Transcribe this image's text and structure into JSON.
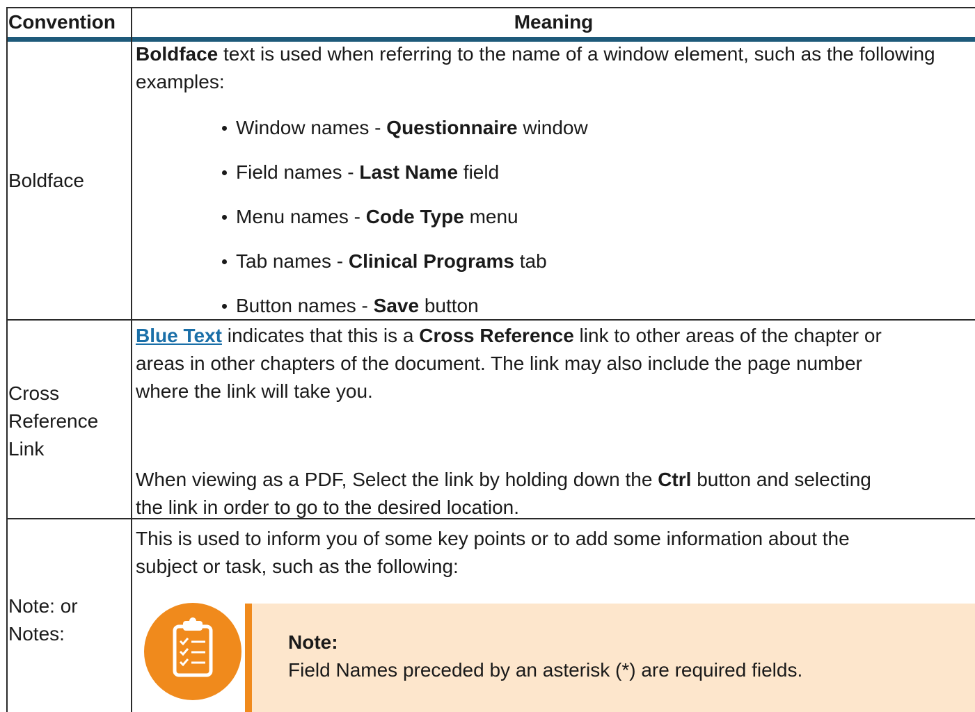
{
  "header": {
    "col1": "Convention",
    "col2": "Meaning"
  },
  "rows": {
    "boldface": {
      "label": "Boldface",
      "intro_bold": "Boldface",
      "intro_rest": "text is used when referring to the name of a window element, such as the following examples:",
      "items": [
        {
          "prefix": "Window names - ",
          "bold": "Questionnaire",
          "suffix": " window"
        },
        {
          "prefix": "Field names - ",
          "bold": "Last Name",
          "suffix": " field"
        },
        {
          "prefix": "Menu names - ",
          "bold": "Code Type",
          "suffix": " menu"
        },
        {
          "prefix": "Tab names - ",
          "bold": "Clinical Programs",
          "suffix": " tab"
        },
        {
          "prefix": "Button names - ",
          "bold": "Save",
          "suffix": " button"
        }
      ]
    },
    "cross_ref": {
      "label_line1": "Cross",
      "label_line2": "Reference",
      "label_line3": "Link",
      "link_text": "Blue Text",
      "p1_mid": " indicates that this is a ",
      "p1_bold": "Cross Reference",
      "p1_line1_end": " link to other areas of the chapter or",
      "p1_line2": "areas in other chapters of the document. The link may also include the page number",
      "p1_line3": "where the link will take you.",
      "p2_line1_start": "When viewing as a PDF, Select the link by holding down the ",
      "p2_bold": "Ctrl",
      "p2_line1_end": " button and selecting",
      "p2_line2": "the link in order to go to the desired location."
    },
    "notes": {
      "label_line1": "Note: or",
      "label_line2": "Notes:",
      "line1": "This is used to inform you of some key points or to add some information about the",
      "line2": "subject or task, such as the following:",
      "note_title": "Note:",
      "note_text": "Field Names preceded by an asterisk (*) are required fields."
    }
  },
  "colors": {
    "accent_blue": "#1e5a7a",
    "link_blue": "#1a6fa8",
    "note_orange": "#f08a1c",
    "note_bg": "#fde6cc"
  },
  "icons": {
    "note": "clipboard-checklist-icon"
  }
}
